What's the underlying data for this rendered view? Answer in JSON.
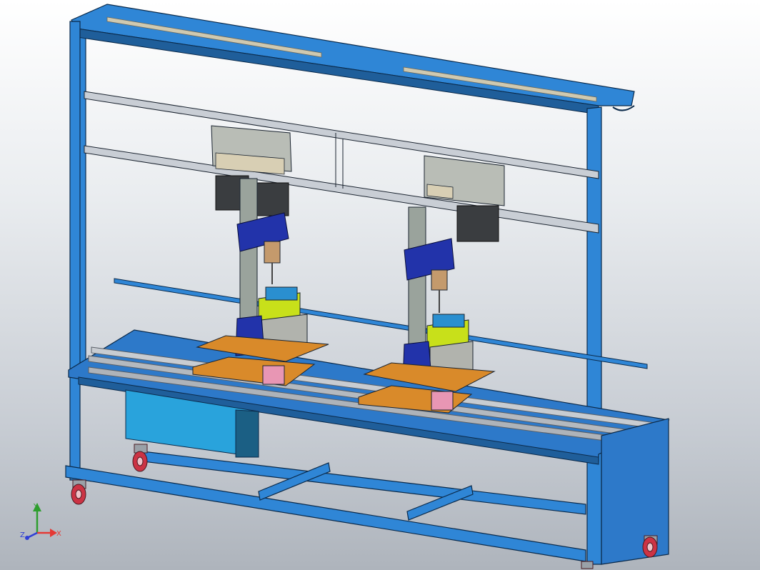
{
  "triad": {
    "x_label": "X",
    "y_label": "Y",
    "z_label": "Z",
    "x_color": "#e53935",
    "y_color": "#2e9e2e",
    "z_color": "#2f3fd6"
  },
  "colors": {
    "frame_blue": "#2f86d6",
    "frame_dark": "#1f5e9a",
    "bench_top": "#2d79c9",
    "control_box": "#29a3dc",
    "drill_head_grey": "#b9bdb6",
    "motor_dark": "#3a3d40",
    "column_grey": "#9aa39c",
    "clamp_blue": "#2233aa",
    "vise_yellow": "#c8e01a",
    "table_orange": "#d98a2a",
    "rail_pink": "#e896b4",
    "caster_red": "#cc3344"
  },
  "assembly": {
    "drill_units": 2,
    "casters": 4
  }
}
